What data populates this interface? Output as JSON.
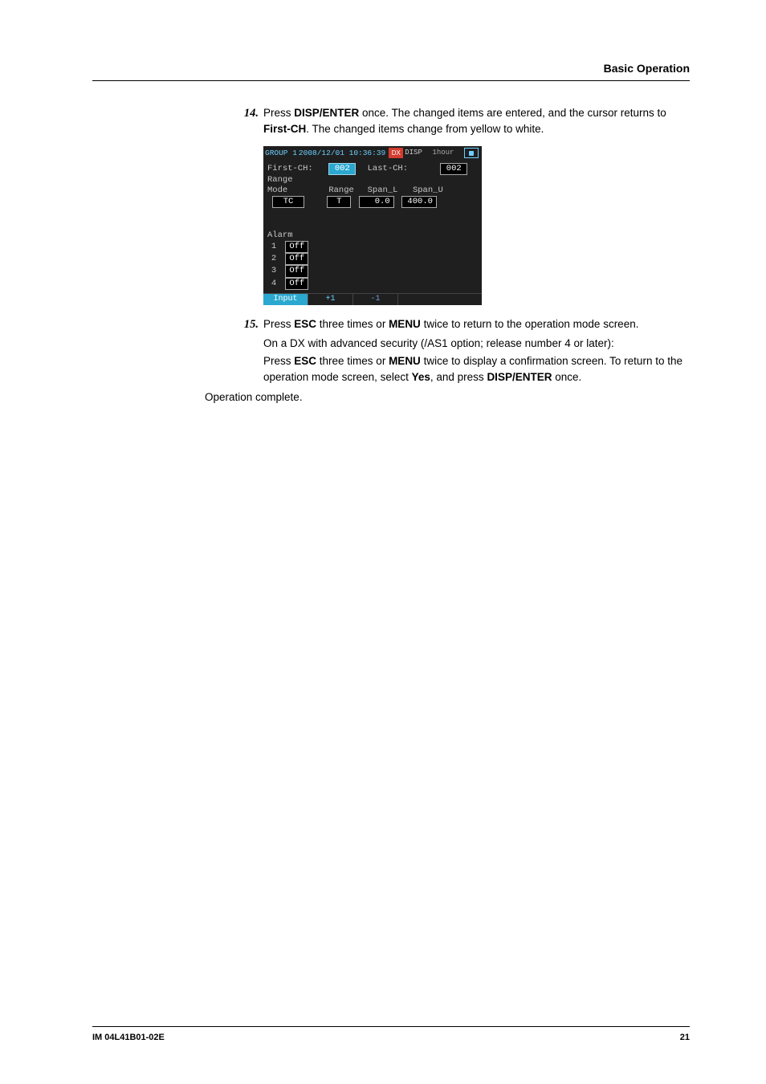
{
  "header": {
    "section_title": "Basic Operation"
  },
  "step14": {
    "num": "14.",
    "text_pre": "Press ",
    "b1": "DISP/ENTER",
    "text_mid1": " once. The changed items are entered, and the cursor returns to ",
    "b2": "First-CH",
    "text_post": ". The changed items change from yellow to white."
  },
  "screenshot": {
    "titlebar": {
      "group": "GROUP 1",
      "datetime": "2008/12/01 10:36:39",
      "icon_text": "DX",
      "disp": "DISP",
      "scale": "1hour"
    },
    "first_ch_label": "First-CH:",
    "first_ch_value": "002",
    "last_ch_label": "Last-CH:",
    "last_ch_value": "002",
    "range_section": "Range",
    "mode_label": "Mode",
    "mode_value": "TC",
    "range_hdr": "Range",
    "range_value": "T",
    "spanl_hdr": "Span_L",
    "spanl_value": "0.0",
    "spanu_hdr": "Span_U",
    "spanu_value": "400.0",
    "alarm_section": "Alarm",
    "alarms": [
      {
        "idx": "1",
        "val": "Off"
      },
      {
        "idx": "2",
        "val": "Off"
      },
      {
        "idx": "3",
        "val": "Off"
      },
      {
        "idx": "4",
        "val": "Off"
      }
    ],
    "bottom": {
      "input": "Input",
      "plus": "+1",
      "minus": "-1"
    }
  },
  "step15": {
    "num": "15.",
    "line1_pre": "Press ",
    "line1_b1": "ESC",
    "line1_mid": " three times or ",
    "line1_b2": "MENU",
    "line1_post": " twice to return to the operation mode screen.",
    "line2": "On a DX with advanced security (/AS1 option; release number 4 or later):",
    "line3_pre": "Press ",
    "line3_b1": "ESC",
    "line3_mid": " three times or ",
    "line3_b2": "MENU",
    "line3_post1": " twice to display a confirmation screen. To return to the operation mode screen, select ",
    "line3_b3": "Yes",
    "line3_post2": ", and press ",
    "line3_b4": "DISP/ENTER",
    "line3_post3": " once."
  },
  "complete": "Operation complete.",
  "footer": {
    "doc": "IM 04L41B01-02E",
    "page": "21"
  }
}
